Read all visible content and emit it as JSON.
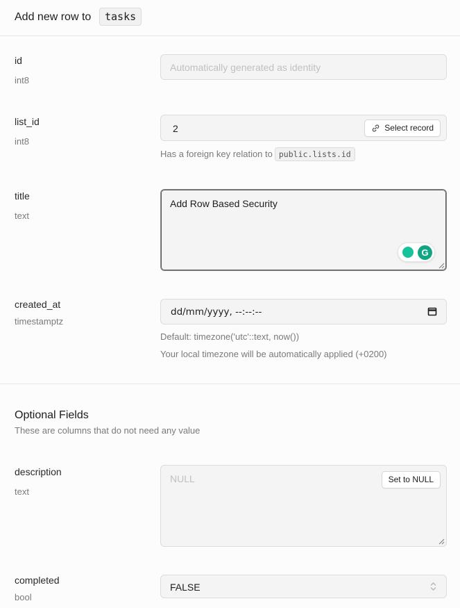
{
  "header": {
    "title": "Add new row to",
    "table": "tasks"
  },
  "fields": [
    {
      "name": "id",
      "type": "int8",
      "placeholder": "Automatically generated as identity"
    },
    {
      "name": "list_id",
      "type": "int8",
      "value": "2",
      "button": "Select record",
      "help": "Has a foreign key relation to",
      "relation": "public.lists.id"
    },
    {
      "name": "title",
      "type": "text",
      "value": "Add Row Based Security"
    },
    {
      "name": "created_at",
      "type": "timestamptz",
      "value": "dd/mm/yyyy, --:--:--",
      "help_default": "Default: timezone('utc'::text, now())",
      "help_tz": "Your local timezone will be automatically applied (+0200)"
    }
  ],
  "optional": {
    "title": "Optional Fields",
    "subtitle": "These are columns that do not need any value",
    "fields": [
      {
        "name": "description",
        "type": "text",
        "placeholder": "NULL",
        "button": "Set to NULL"
      },
      {
        "name": "completed",
        "type": "bool",
        "value": "FALSE"
      }
    ]
  },
  "icons": {
    "link": "link-icon",
    "calendar": "calendar-icon",
    "select": "chevron-up-down-icon",
    "grammarly": "grammarly-icon"
  }
}
